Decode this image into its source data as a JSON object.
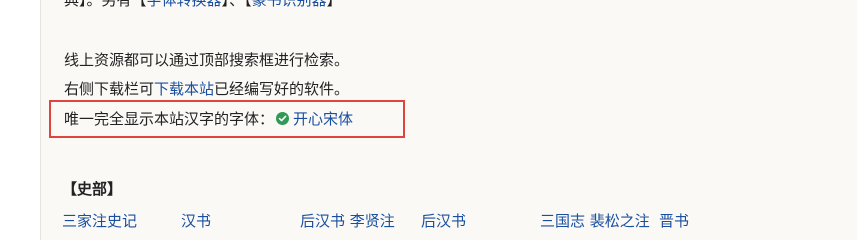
{
  "intro": {
    "cut_prefix": "典】。另有",
    "link_converter": "字体转换器",
    "sep": "、",
    "link_identifier": "篆书识别器",
    "bracket_open": "【",
    "bracket_close": "】"
  },
  "notes": {
    "search_text": "线上资源都可以通过顶部搜索框进行检索。",
    "download_prefix": "右侧下载栏可",
    "download_link": "下载本站",
    "download_suffix": "已经编写好的软件。",
    "font_prefix": "唯一完全显示本站汉字的字体：",
    "font_name": "开心宋体"
  },
  "shibu": {
    "heading": "【史部】",
    "books": [
      "三家注史记",
      "汉书",
      "后汉书 李贤注",
      "后汉书",
      "三国志 裴松之注",
      "晋书"
    ]
  },
  "colors": {
    "link": "#1a4fa0",
    "highlight_border": "#e0443e",
    "check": "#2f9a54"
  },
  "icons": {
    "font_status": "check-circle-icon"
  }
}
